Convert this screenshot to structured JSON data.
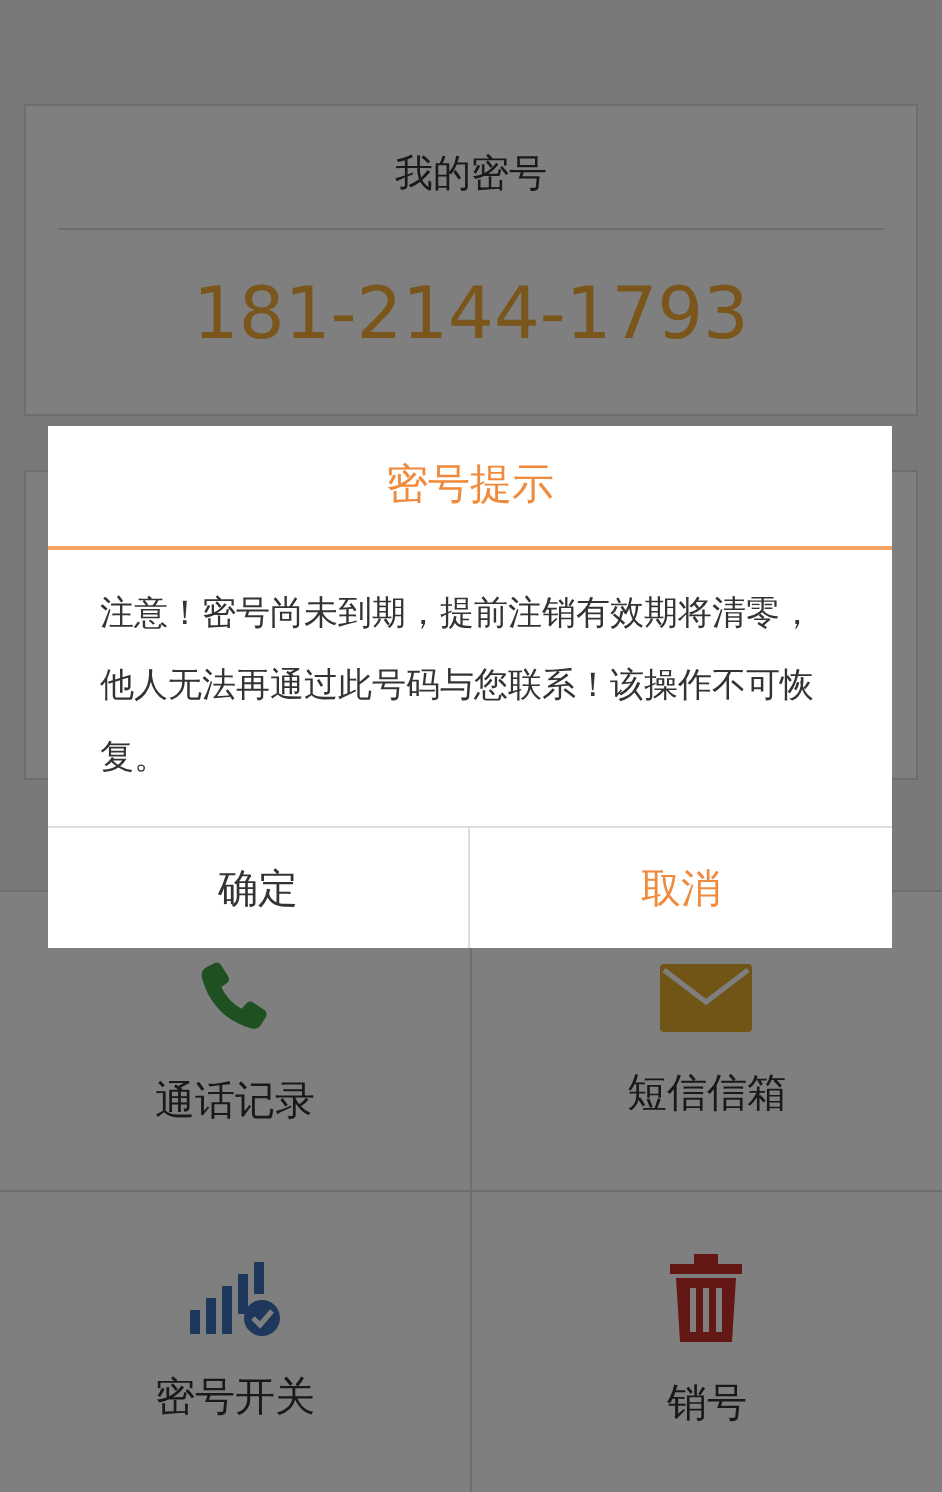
{
  "my_password": {
    "title": "我的密号",
    "number": "181-2144-1793"
  },
  "menu": [
    {
      "label": "通话记录",
      "kind": "phone"
    },
    {
      "label": "短信信箱",
      "kind": "mail"
    },
    {
      "label": "密号开关",
      "kind": "signal"
    },
    {
      "label": "销号",
      "kind": "trash"
    }
  ],
  "dialog": {
    "title": "密号提示",
    "message": "注意！密号尚未到期，提前注销有效期将清零，他人无法再通过此号码与您联系！该操作不可恢复。",
    "buttons": [
      {
        "label": "确定",
        "kind": "confirm"
      },
      {
        "label": "取消",
        "kind": "cancel"
      }
    ]
  }
}
